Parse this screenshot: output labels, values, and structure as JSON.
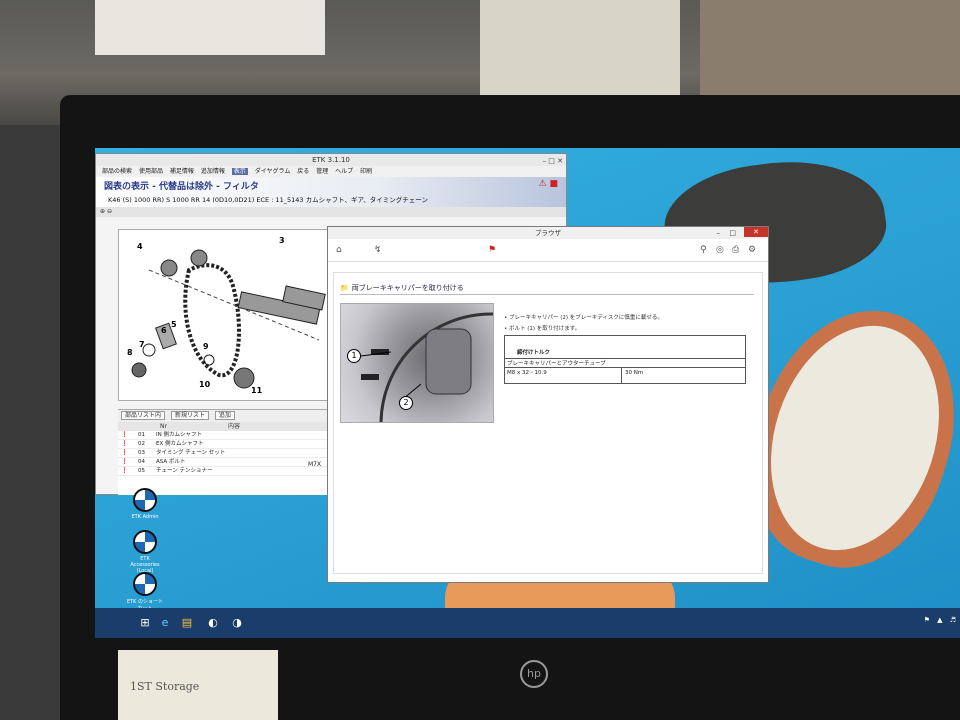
{
  "etk": {
    "title": "ETK 3.1.10",
    "menu": [
      "部品の検索",
      "使用部品",
      "補足情報",
      "追加情報",
      "表示",
      "ダイヤグラム",
      "戻る",
      "管理",
      "ヘルプ",
      "印刷"
    ],
    "menu_highlight_index": 4,
    "header_title": "図表の表示 - 代替品は除外 - フィルタ",
    "header_sub": "K46 (S) 1000 RR) S 1000 RR 14 (0D10,0D21) ECE : 11_5143 カムシャフト、ギア、タイミングチェーン",
    "diagram_callouts": [
      "4",
      "3",
      "5",
      "6",
      "7",
      "8",
      "9",
      "10",
      "11",
      "10"
    ],
    "parts_toolbar": {
      "list_selector": "部品リスト内",
      "list_mode": "新規リスト",
      "add_button": "追加"
    },
    "parts_header": {
      "col_no": "Nr",
      "col_name": "内容"
    },
    "parts_rows": [
      {
        "no": "01",
        "name": "IN 側カムシャフト"
      },
      {
        "no": "02",
        "name": "EX 側カムシャフト"
      },
      {
        "no": "03",
        "name": "タイミング チェーン セット"
      },
      {
        "no": "04",
        "name": "ASA ボルト"
      },
      {
        "no": "05",
        "name": "チェーン テンショナー"
      }
    ],
    "parts_side_code": "M7X"
  },
  "browser": {
    "title": "ブラウザ",
    "section_title": "両ブレーキキャリパーを取り付ける",
    "steps": [
      "ブレーキキャリパー (2) をブレーキディスクに慎重に載せる。",
      "ボルト (1) を取り付けます。"
    ],
    "photo_callouts": [
      "1",
      "2"
    ],
    "torque": {
      "heading": "締付けトルク",
      "row_label": "ブレーキキャリパーとアウターチューブ",
      "spec": "M8 x 32 - 10.9",
      "value": "30 Nm"
    }
  },
  "desktop": {
    "icons": [
      {
        "label": "ETK Admin"
      },
      {
        "label": "ETK Accessories (Local)"
      },
      {
        "label": "ETK のショートカット"
      }
    ]
  },
  "bezel": {
    "brand": "hp"
  },
  "paper_note": "1ST Storage"
}
